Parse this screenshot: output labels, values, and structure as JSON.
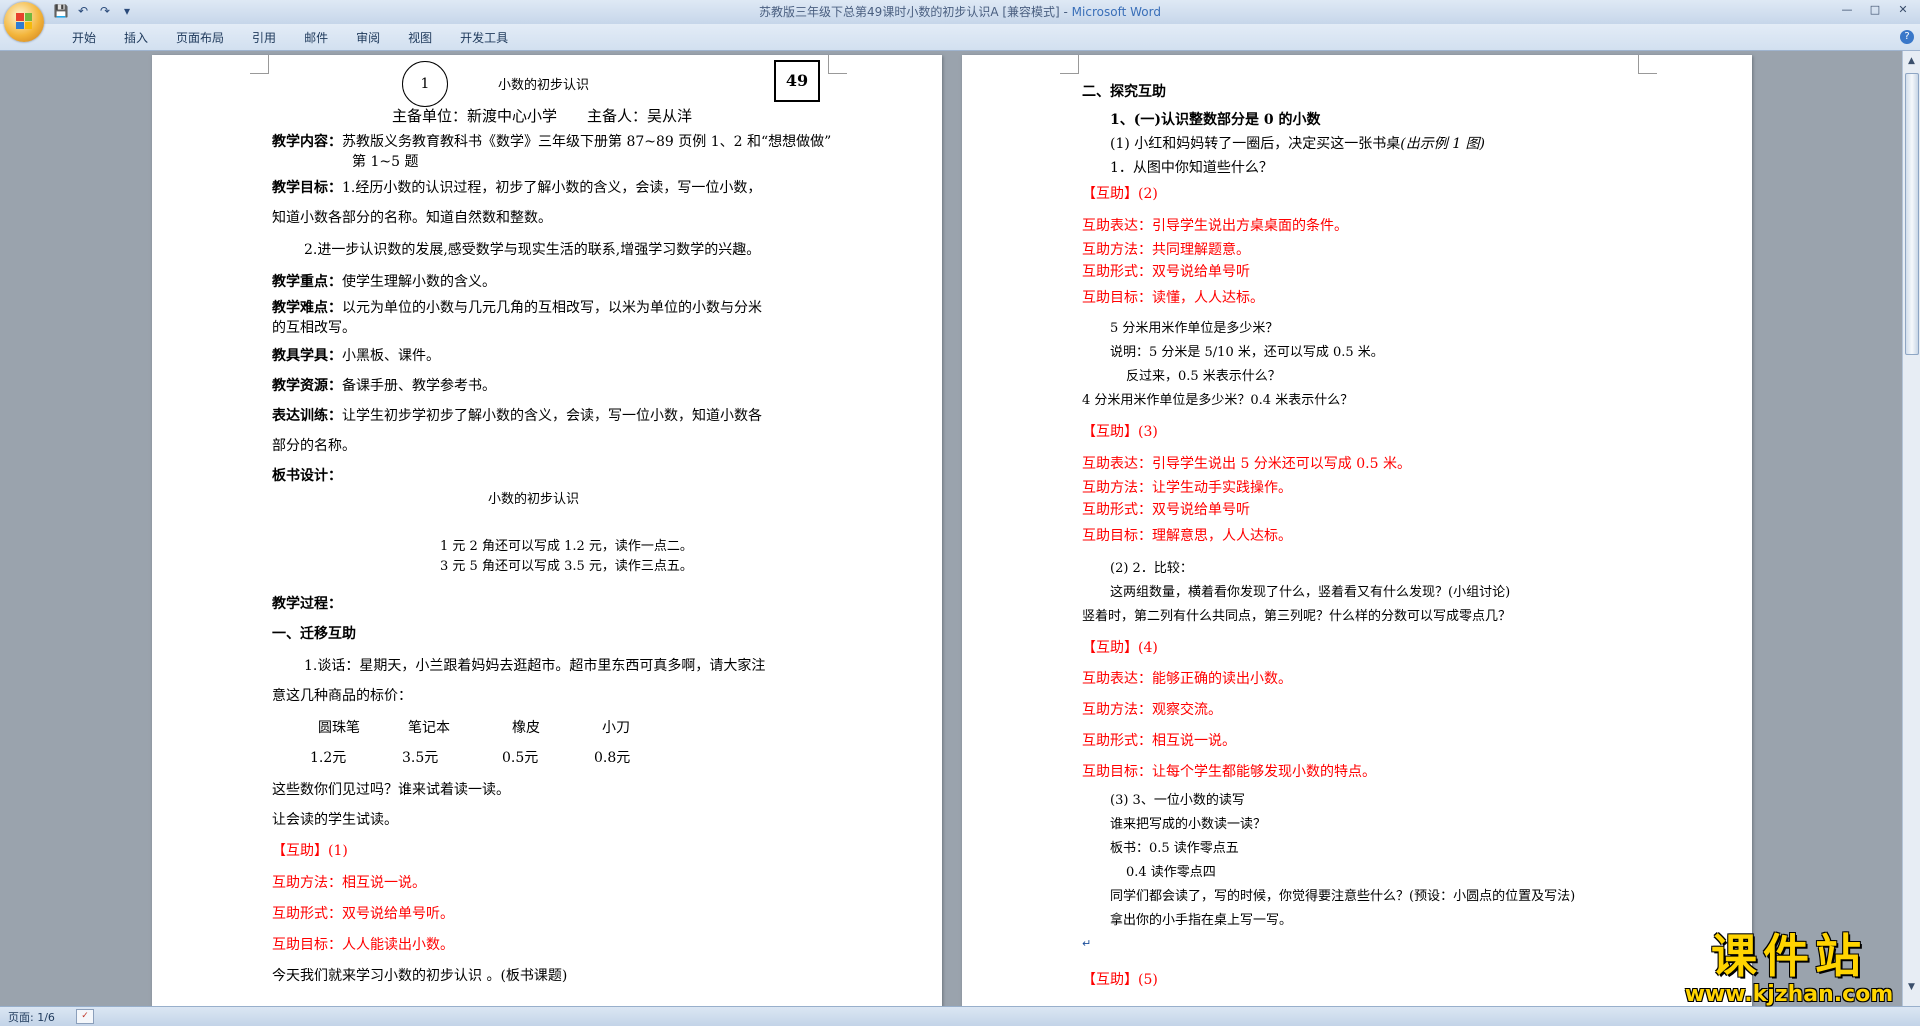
{
  "window": {
    "title": "苏教版三年级下总第49课时小数的初步认识A [兼容模式] - ",
    "app_name": "Microsoft Word"
  },
  "quick_access": [
    "save-icon",
    "undo-icon",
    "redo-icon",
    "customize-icon"
  ],
  "ribbon": {
    "tabs": [
      "开始",
      "插入",
      "页面布局",
      "引用",
      "邮件",
      "审阅",
      "视图",
      "开发工具"
    ]
  },
  "page1": {
    "circle_num": "1",
    "title": "小数的初步认识",
    "box_num": "49",
    "host_line": "主备单位：新渡中心小学　　主备人：吴从洋",
    "content_label": "教学内容：",
    "content_text": "苏教版义务教育教科书《数学》三年级下册第 87~89 页例 1、2 和“想想做做”",
    "content_text2": "第 1~5 题",
    "goal_label": "教学目标：",
    "goal_1a": "1.经历小数的认识过程，初步了解小数的含义，会读，写一位小数，",
    "goal_1b": "知道小数各部分的名称。知道自然数和整数。",
    "goal_2": "2.进一步认识数的发展,感受数学与现实生活的联系,增强学习数学的兴趣。",
    "key_label": "教学重点：",
    "key_text": "使学生理解小数的含义。",
    "diff_label": "教学难点：",
    "diff_text": "以元为单位的小数与几元几角的互相改写，以米为单位的小数与分米",
    "diff_text2": "的互相改写。",
    "tools_label": "教具学具：",
    "tools_text": "小黑板、课件。",
    "res_label": "教学资源：",
    "res_text": "备课手册、教学参考书。",
    "exp_label": "表达训练：",
    "exp_text": "让学生初步学初步了解小数的含义，会读，写一位小数，知道小数各",
    "exp_text2": "部分的名称。",
    "board_label": "板书设计：",
    "board_title": "小数的初步认识",
    "board_1": "1 元 2 角还可以写成 1.2 元，读作一点二。",
    "board_2": "3 元 5 角还可以写成 3.5 元，读作三点五。",
    "process_label": "教学过程：",
    "sec1": "一、迁移互助",
    "talk_1": "1.谈话：星期天，小兰跟着妈妈去逛超市。超市里东西可真多啊，请大家注",
    "talk_2": "意这几种商品的标价：",
    "items": [
      "圆珠笔",
      "笔记本",
      "橡皮",
      "小刀"
    ],
    "prices": [
      "1.2元",
      "3.5元",
      "0.5元",
      "0.8元"
    ],
    "q1": "这些数你们见过吗？谁来试着读一读。",
    "q2": "让会读的学生试读。",
    "hz1_tag": "【互助】",
    "hz1_num": "(1)",
    "hz1_method": "互助方法：相互说一说。",
    "hz1_form": "互助形式：双号说给单号听。",
    "hz1_goal": "互助目标：人人能读出小数。",
    "last": "今天我们就来学习小数的初步认识 。(板书课题)"
  },
  "page2": {
    "sec2": "二、探究互助",
    "sub1": "1、(一)认识整数部分是 0 的小数",
    "p1": "(1) 小红和妈妈转了一圈后，决定买这一张书桌",
    "p1_italic": "(出示例 1 图)",
    "p2": "1．从图中你知道些什么？",
    "hz2_tag": "【互助】",
    "hz2_num": "(2)",
    "hz2_exp": "互助表达：引导学生说出方桌桌面的条件。",
    "hz2_method": "互助方法：共同理解题意。",
    "hz2_form": "互助形式：双号说给单号听",
    "hz2_goal": "互助目标：读懂，人人达标。",
    "q_5fen": "5 分米用米作单位是多少米？",
    "q_explain": "说明：5 分米是 5/10 米，还可以写成 0.5 米。",
    "q_reverse": "反过来，0.5 米表示什么？",
    "q_4fen": "4 分米用米作单位是多少米？0.4 米表示什么？",
    "hz3_tag": "【互助】",
    "hz3_num": "(3)",
    "hz3_exp": "互助表达：引导学生说出 5 分米还可以写成 0.5 米。",
    "hz3_method": "互助方法：让学生动手实践操作。",
    "hz3_form": "互助形式：双号说给单号听",
    "hz3_goal": "互助目标：理解意思，人人达标。",
    "cmp_head": "(2) 2．比较：",
    "cmp_1": "这两组数量，横着看你发现了什么，竖着看又有什么发现？(小组讨论)",
    "cmp_2": "竖着时，第二列有什么共同点，第三列呢？什么样的分数可以写成零点几？",
    "hz4_tag": "【互助】",
    "hz4_num": "(4)",
    "hz4_exp": "互助表达：能够正确的读出小数。",
    "hz4_method": "互助方法：观察交流。",
    "hz4_form": "互助形式：相互说一说。",
    "hz4_goal": "互助目标：让每个学生都能够发现小数的特点。",
    "rw_head": "(3) 3、一位小数的读写",
    "rw_1": "谁来把写成的小数读一读？",
    "rw_2": "板书：0.5 读作零点五",
    "rw_3": "0.4 读作零点四",
    "rw_4": "同学们都会读了，写的时候，你觉得要注意些什么？(预设：小圆点的位置及写法)",
    "rw_5": "拿出你的小手指在桌上写一写。",
    "hz5_tag": "【互助】",
    "hz5_num": "(5)"
  },
  "status": {
    "page": "页面: 1/6"
  },
  "watermark": {
    "big": "课件站",
    "url": "www.kjzhan.com"
  },
  "colors": {
    "accent_red": "#ff0000",
    "ribbon_blue": "#d2e0f0",
    "watermark_yellow": "#ffd400"
  }
}
